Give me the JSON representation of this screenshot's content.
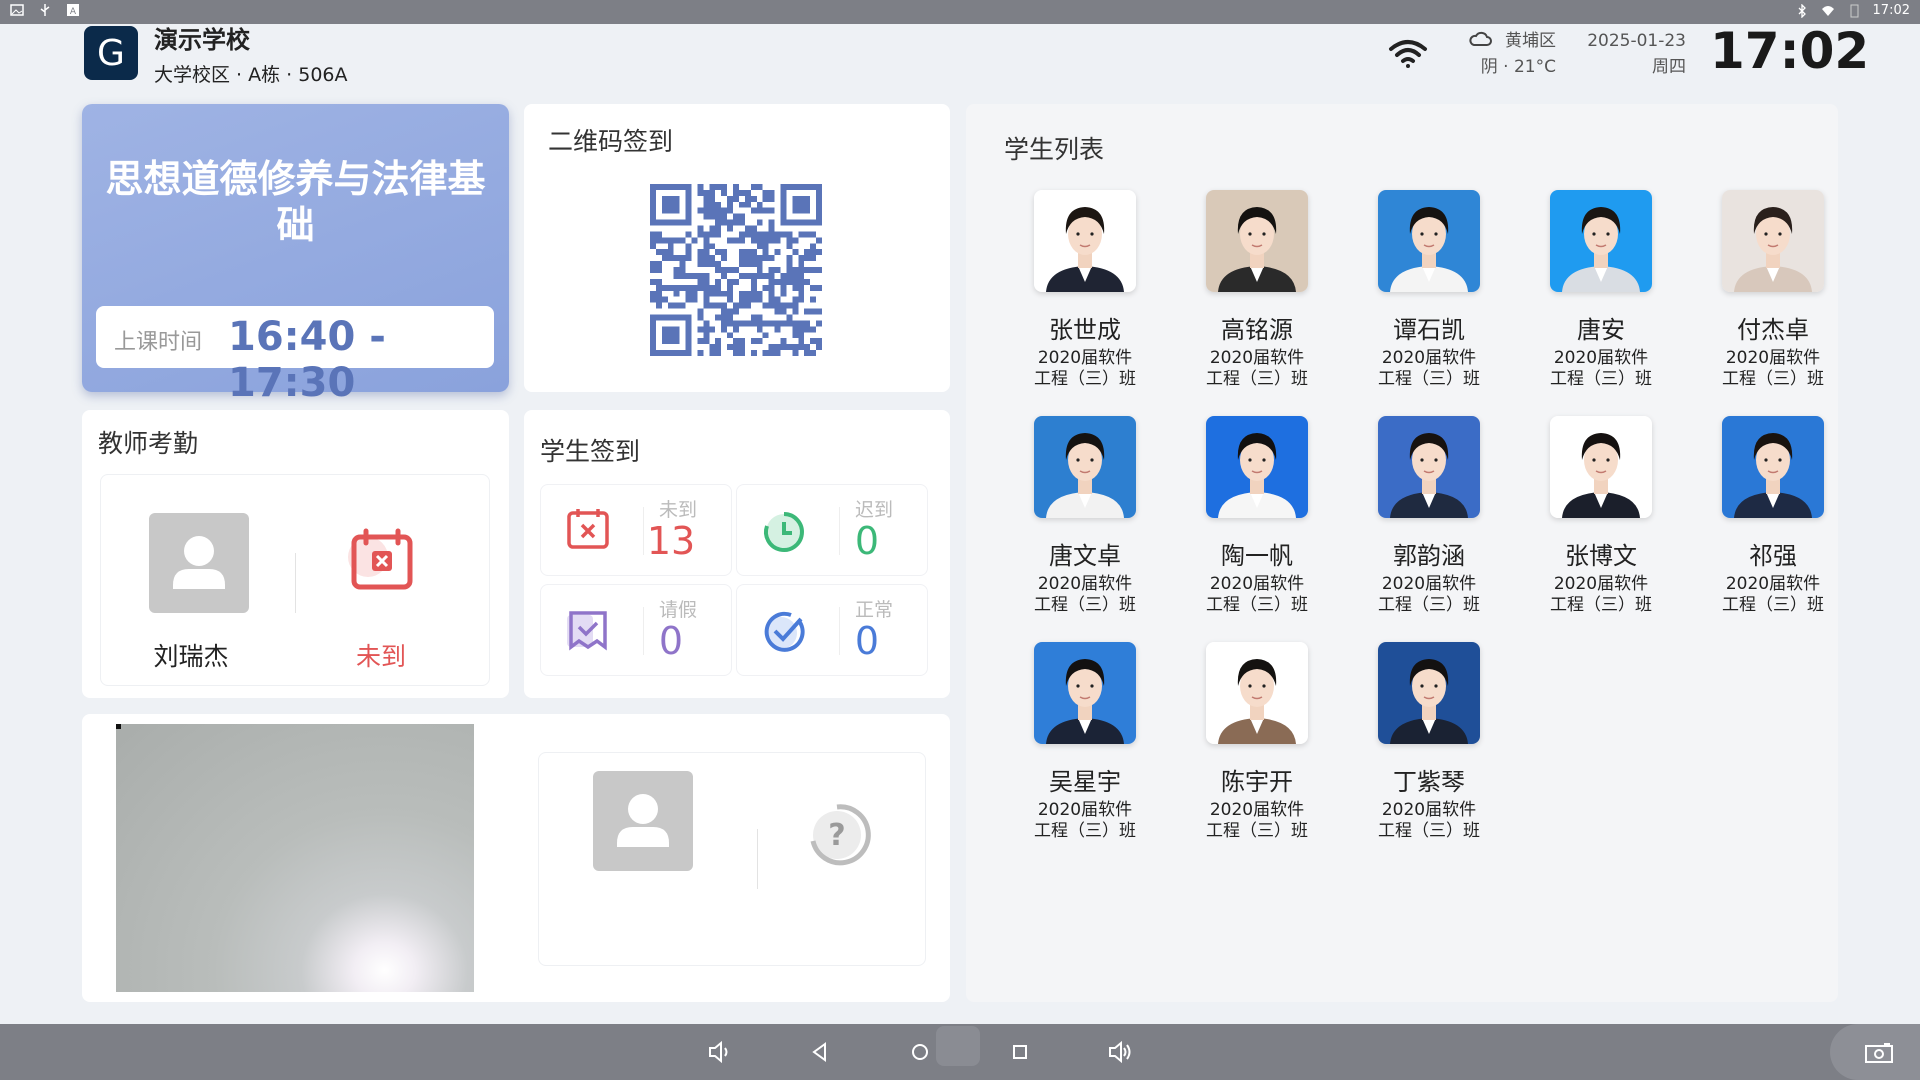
{
  "status_bar": {
    "time": "17:02"
  },
  "header": {
    "logo_letter": "G",
    "school_name": "演示学校",
    "location": "大学校区 · A栋 · 506A",
    "weather_area": "黄埔区",
    "weather_desc": "阴 · 21°C",
    "date": "2025-01-23",
    "weekday": "周四",
    "clock": "17:02"
  },
  "course": {
    "title": "思想道德修养与法律基础",
    "time_label": "上课时间",
    "time_value": "16:40 - 17:30"
  },
  "qr": {
    "title": "二维码签到"
  },
  "teacher": {
    "title": "教师考勤",
    "name": "刘瑞杰",
    "status": "未到"
  },
  "sign": {
    "title": "学生签到",
    "stats": [
      {
        "label": "未到",
        "value": "13",
        "color": "#e25555"
      },
      {
        "label": "迟到",
        "value": "0",
        "color": "#3cb878"
      },
      {
        "label": "请假",
        "value": "0",
        "color": "#8f74c9"
      },
      {
        "label": "正常",
        "value": "0",
        "color": "#4a7bd8"
      }
    ]
  },
  "roster": {
    "title": "学生列表",
    "class_line1": "2020届软件",
    "class_line2": "工程（三）班",
    "students": [
      {
        "name": "张世成",
        "bg": "#ffffff",
        "hair": "#1c1612",
        "suit": "#1f2433"
      },
      {
        "name": "高铭源",
        "bg": "#d9c9b8",
        "hair": "#141210",
        "suit": "#2a2a2a"
      },
      {
        "name": "谭石凯",
        "bg": "#2f86d6",
        "hair": "#161311",
        "suit": "#f4f4f4"
      },
      {
        "name": "唐安",
        "bg": "#1f9bf0",
        "hair": "#1a1613",
        "suit": "#d9dde3"
      },
      {
        "name": "付杰卓",
        "bg": "#e9e3df",
        "hair": "#2a201c",
        "suit": "#d8c8bc"
      },
      {
        "name": "唐文卓",
        "bg": "#2d7fd0",
        "hair": "#151210",
        "suit": "#f2f2f2"
      },
      {
        "name": "陶一帆",
        "bg": "#1e6fe0",
        "hair": "#121010",
        "suit": "#f6f6f6"
      },
      {
        "name": "郭韵涵",
        "bg": "#3b6cc6",
        "hair": "#17120f",
        "suit": "#1f2a40"
      },
      {
        "name": "张博文",
        "bg": "#ffffff",
        "hair": "#151110",
        "suit": "#1b1f2b"
      },
      {
        "name": "祁强",
        "bg": "#2a78d6",
        "hair": "#19130f",
        "suit": "#1e2a44"
      },
      {
        "name": "吴星宇",
        "bg": "#2f7ed8",
        "hair": "#131111",
        "suit": "#1b2336"
      },
      {
        "name": "陈宇开",
        "bg": "#ffffff",
        "hair": "#141210",
        "suit": "#8a6b55"
      },
      {
        "name": "丁紫琴",
        "bg": "#1f4f98",
        "hair": "#131111",
        "suit": "#1a2233"
      }
    ]
  },
  "nav": {
    "buttons": [
      "volume-down",
      "back",
      "home",
      "recents",
      "volume-up",
      "screenshot"
    ]
  }
}
